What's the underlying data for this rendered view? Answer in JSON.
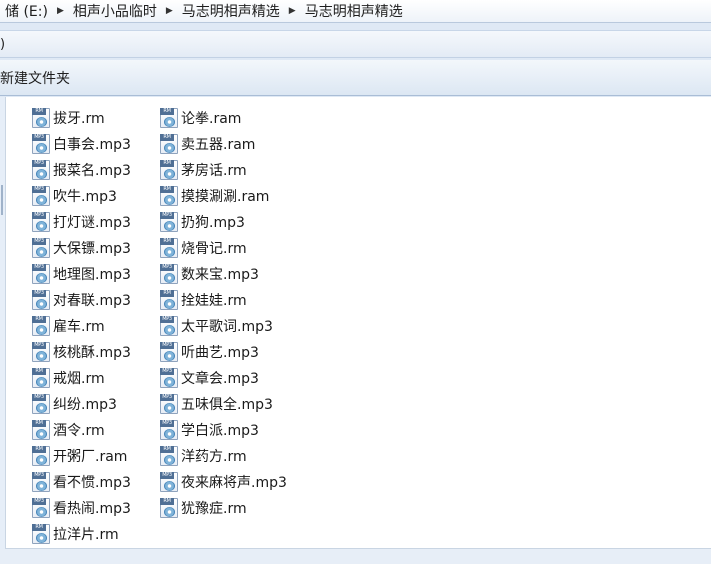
{
  "breadcrumb": {
    "drive": "储 (E:)",
    "level1": "相声小品临时",
    "level2": "马志明相声精选",
    "level3": "马志明相声精选"
  },
  "menubar": {
    "edge_text": ")"
  },
  "commandbar": {
    "new_folder": "新建文件夹"
  },
  "files": {
    "column1": [
      {
        "name": "拔牙.rm",
        "type": "RM"
      },
      {
        "name": "白事会.mp3",
        "type": "MP3"
      },
      {
        "name": "报菜名.mp3",
        "type": "MP3"
      },
      {
        "name": "吹牛.mp3",
        "type": "MP3"
      },
      {
        "name": "打灯谜.mp3",
        "type": "MP3"
      },
      {
        "name": "大保镖.mp3",
        "type": "MP3"
      },
      {
        "name": "地理图.mp3",
        "type": "MP3"
      },
      {
        "name": "对春联.mp3",
        "type": "MP3"
      },
      {
        "name": "雇车.rm",
        "type": "RM"
      },
      {
        "name": "核桃酥.mp3",
        "type": "MP3"
      },
      {
        "name": "戒烟.rm",
        "type": "RM"
      },
      {
        "name": "纠纷.mp3",
        "type": "MP3"
      },
      {
        "name": "酒令.rm",
        "type": "RM"
      },
      {
        "name": "开粥厂.ram",
        "type": "RM"
      },
      {
        "name": "看不惯.mp3",
        "type": "MP3"
      },
      {
        "name": "看热闹.mp3",
        "type": "MP3"
      },
      {
        "name": "拉洋片.rm",
        "type": "RM"
      }
    ],
    "column2": [
      {
        "name": "论拳.ram",
        "type": "RM"
      },
      {
        "name": "卖五器.ram",
        "type": "RM"
      },
      {
        "name": "茅房话.rm",
        "type": "RM"
      },
      {
        "name": "摸摸涮涮.ram",
        "type": "RM"
      },
      {
        "name": "扔狗.mp3",
        "type": "MP3"
      },
      {
        "name": "烧骨记.rm",
        "type": "RM"
      },
      {
        "name": "数来宝.mp3",
        "type": "MP3"
      },
      {
        "name": "拴娃娃.rm",
        "type": "RM"
      },
      {
        "name": "太平歌词.mp3",
        "type": "MP3"
      },
      {
        "name": "听曲艺.mp3",
        "type": "MP3"
      },
      {
        "name": "文章会.mp3",
        "type": "MP3"
      },
      {
        "name": "五味俱全.mp3",
        "type": "MP3"
      },
      {
        "name": "学白派.mp3",
        "type": "MP3"
      },
      {
        "name": "洋药方.rm",
        "type": "RM"
      },
      {
        "name": "夜来麻将声.mp3",
        "type": "MP3"
      },
      {
        "name": "犹豫症.rm",
        "type": "RM"
      }
    ]
  }
}
